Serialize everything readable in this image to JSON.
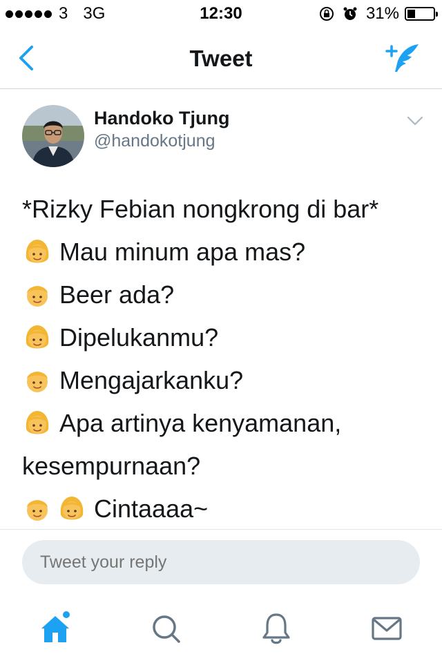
{
  "status_bar": {
    "carrier": "3",
    "network": "3G",
    "time": "12:30",
    "battery_percent": "31%",
    "battery_level": 0.31
  },
  "nav": {
    "title": "Tweet",
    "back_icon": "chevron-left-icon",
    "compose_icon": "compose-tweet-icon",
    "accent_color": "#1da1f2"
  },
  "tweet": {
    "author_name": "Handoko Tjung",
    "author_handle": "@handokotjung",
    "lines": [
      {
        "emojis": [],
        "text": "*Rizky Febian nongkrong di bar*"
      },
      {
        "emojis": [
          "woman"
        ],
        "text": "Mau minum apa mas?"
      },
      {
        "emojis": [
          "man"
        ],
        "text": "Beer ada?"
      },
      {
        "emojis": [
          "woman"
        ],
        "text": "Dipelukanmu?"
      },
      {
        "emojis": [
          "man"
        ],
        "text": "Mengajarkanku?"
      },
      {
        "emojis": [
          "woman"
        ],
        "text": "Apa artinya kenyamanan,"
      },
      {
        "emojis": [],
        "text": "kesempurnaan?"
      },
      {
        "emojis": [
          "man",
          "woman"
        ],
        "text": "Cintaaaa~"
      }
    ]
  },
  "reply": {
    "placeholder": "Tweet your reply"
  },
  "tab_bar": {
    "items": [
      {
        "icon": "home-icon",
        "active": true
      },
      {
        "icon": "search-icon",
        "active": false
      },
      {
        "icon": "notifications-bell-icon",
        "active": false
      },
      {
        "icon": "messages-envelope-icon",
        "active": false
      }
    ]
  }
}
